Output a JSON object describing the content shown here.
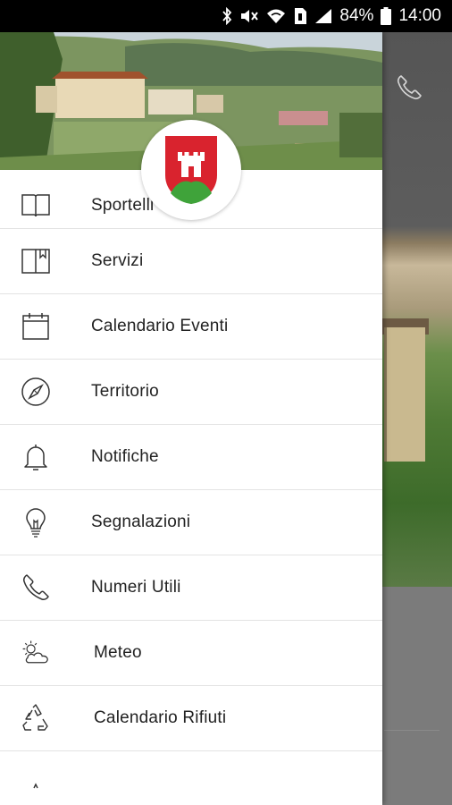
{
  "status_bar": {
    "battery": "84%",
    "time": "14:00"
  },
  "drawer": {
    "menu_items": [
      {
        "label": "Sportelli",
        "icon": "book-open-icon"
      },
      {
        "label": "Servizi",
        "icon": "book-icon"
      },
      {
        "label": "Calendario Eventi",
        "icon": "calendar-icon"
      },
      {
        "label": "Territorio",
        "icon": "compass-icon"
      },
      {
        "label": "Notifiche",
        "icon": "bell-icon"
      },
      {
        "label": "Segnalazioni",
        "icon": "lightbulb-icon"
      },
      {
        "label": "Numeri Utili",
        "icon": "phone-icon"
      },
      {
        "label": "Meteo",
        "icon": "weather-icon"
      },
      {
        "label": "Calendario Rifiuti",
        "icon": "recycle-icon"
      }
    ]
  },
  "colors": {
    "crest_red": "#d9232e",
    "crest_green": "#3fa33a",
    "drawer_bg": "#ffffff",
    "divider": "#e3e3e3"
  }
}
